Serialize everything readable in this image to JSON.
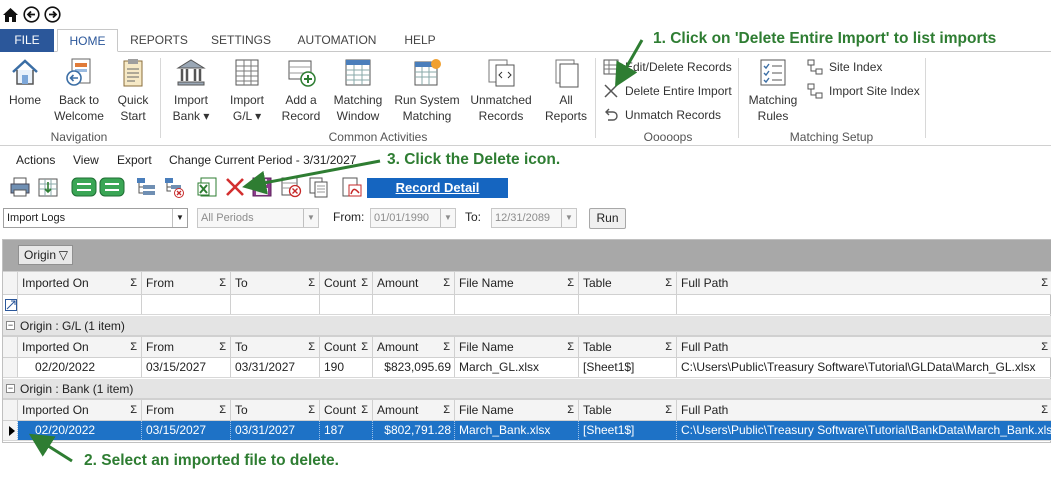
{
  "ribbon_tabs": [
    "FILE",
    "HOME",
    "REPORTS",
    "SETTINGS",
    "AUTOMATION",
    "HELP"
  ],
  "ribbon": {
    "buttons": [
      {
        "label": "Home",
        "icon": "home-icon"
      },
      {
        "label": "Back to\nWelcome",
        "icon": "back-welcome-icon"
      },
      {
        "label": "Quick\nStart",
        "icon": "clipboard-icon"
      },
      {
        "label": "Import\nBank ▾",
        "icon": "bank-icon"
      },
      {
        "label": "Import\nG/L ▾",
        "icon": "ledger-icon"
      },
      {
        "label": "Add a\nRecord",
        "icon": "add-record-icon"
      },
      {
        "label": "Matching\nWindow",
        "icon": "matching-window-icon"
      },
      {
        "label": "Run System\nMatching",
        "icon": "run-matching-icon"
      },
      {
        "label": "Unmatched\nRecords",
        "icon": "unmatched-icon"
      },
      {
        "label": "All\nReports",
        "icon": "reports-icon"
      },
      {
        "label": "Matching\nRules",
        "icon": "rules-icon"
      }
    ],
    "small_buttons": [
      "Edit/Delete Records",
      "Delete Entire Import",
      "Unmatch Records",
      "Site Index",
      "Import Site Index"
    ],
    "groups": [
      "Navigation",
      "Common Activities",
      "Ooooops",
      "Matching Setup"
    ]
  },
  "menubar": [
    "Actions",
    "View",
    "Export",
    "Change Current Period - 3/31/2027"
  ],
  "record_detail": "Record Detail",
  "filter": {
    "view_select": "Import Logs",
    "period_select": "All Periods",
    "from_label": "From:",
    "from_value": "01/01/1990",
    "to_label": "To:",
    "to_value": "12/31/2089",
    "run_label": "Run"
  },
  "grid": {
    "group_chip": "Origin",
    "columns": [
      "Imported On",
      "From",
      "To",
      "Count",
      "Amount",
      "File Name",
      "Table",
      "Full Path"
    ],
    "sigma": "Σ",
    "groups": [
      {
        "title": "Origin : G/L (1 item)",
        "rows": [
          {
            "imported_on": "02/20/2022",
            "from": "03/15/2027",
            "to": "03/31/2027",
            "count": "190",
            "amount": "$823,095.69",
            "file": "March_GL.xlsx",
            "table": "[Sheet1$]",
            "path": "C:\\Users\\Public\\Treasury Software\\Tutorial\\GLData\\March_GL.xlsx"
          }
        ]
      },
      {
        "title": "Origin : Bank (1 item)",
        "rows": [
          {
            "imported_on": "02/20/2022",
            "from": "03/15/2027",
            "to": "03/31/2027",
            "count": "187",
            "amount": "$802,791.28",
            "file": "March_Bank.xlsx",
            "table": "[Sheet1$]",
            "path": "C:\\Users\\Public\\Treasury Software\\Tutorial\\BankData\\March_Bank.xlsx"
          }
        ]
      }
    ]
  },
  "annotations": [
    "1. Click on 'Delete Entire Import' to list imports",
    "2. Select an imported file to delete.",
    "3. Click the Delete icon."
  ],
  "colors": {
    "accent": "#2b579a",
    "selection": "#1e72c6",
    "annotation": "#2e7d32",
    "record_detail": "#1565c0"
  }
}
